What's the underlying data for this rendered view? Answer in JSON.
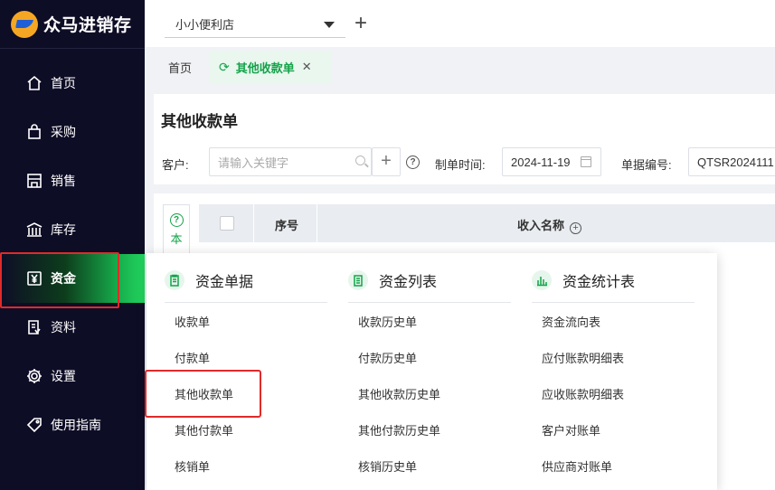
{
  "app": {
    "logo_text": "众马进销存"
  },
  "topbar": {
    "store": "小小便利店"
  },
  "tabs": [
    {
      "label": "首页"
    },
    {
      "label": "其他收款单",
      "active": true
    }
  ],
  "sidebar": {
    "items": [
      {
        "label": "首页",
        "icon": "home-icon"
      },
      {
        "label": "采购",
        "icon": "bag-icon"
      },
      {
        "label": "销售",
        "icon": "store-icon"
      },
      {
        "label": "库存",
        "icon": "warehouse-icon"
      },
      {
        "label": "资金",
        "icon": "yuan-icon",
        "active": true
      },
      {
        "label": "资料",
        "icon": "document-icon"
      },
      {
        "label": "设置",
        "icon": "gear-icon"
      },
      {
        "label": "使用指南",
        "icon": "tag-icon"
      }
    ]
  },
  "page": {
    "title": "其他收款单",
    "filters": {
      "customer_label": "客户:",
      "customer_placeholder": "请输入关键字",
      "date_label": "制单时间:",
      "date_value": "2024-11-19",
      "docno_label": "单据编号:",
      "docno_value": "QTSR2024111"
    },
    "table": {
      "side_label": "本",
      "headers": [
        "序号",
        "收入名称"
      ]
    }
  },
  "menu": {
    "columns": [
      {
        "title": "资金单据",
        "icon": "clipboard-icon",
        "items": [
          "收款单",
          "付款单",
          "其他收款单",
          "其他付款单",
          "核销单"
        ]
      },
      {
        "title": "资金列表",
        "icon": "list-icon",
        "items": [
          "收款历史单",
          "付款历史单",
          "其他收款历史单",
          "其他付款历史单",
          "核销历史单"
        ]
      },
      {
        "title": "资金统计表",
        "icon": "bar-chart-icon",
        "items": [
          "资金流向表",
          "应付账款明细表",
          "应收账款明细表",
          "客户对账单",
          "供应商对账单"
        ]
      }
    ]
  },
  "colors": {
    "accent": "#14a34a",
    "sidebar_bg": "#0e0d26",
    "highlight_box": "#e02a2a"
  }
}
